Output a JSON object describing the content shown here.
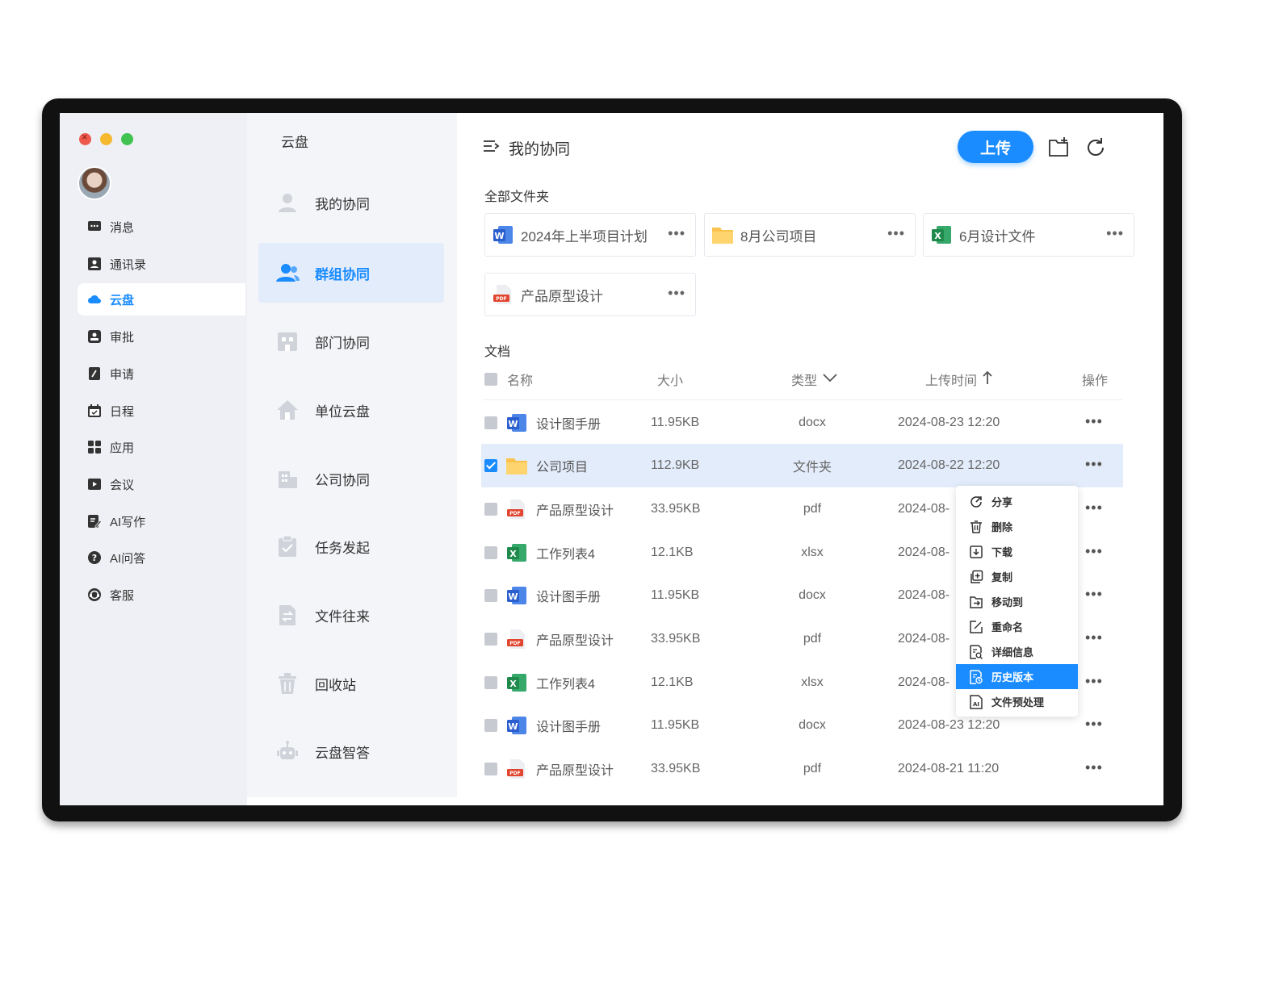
{
  "rail": {
    "items": [
      {
        "label": "消息",
        "icon": "message-icon"
      },
      {
        "label": "通讯录",
        "icon": "contacts-icon"
      },
      {
        "label": "云盘",
        "icon": "cloud-icon",
        "active": true
      },
      {
        "label": "审批",
        "icon": "approval-icon"
      },
      {
        "label": "申请",
        "icon": "apply-icon"
      },
      {
        "label": "日程",
        "icon": "calendar-icon"
      },
      {
        "label": "应用",
        "icon": "apps-icon"
      },
      {
        "label": "会议",
        "icon": "meeting-icon"
      },
      {
        "label": "AI写作",
        "icon": "ai-write-icon"
      },
      {
        "label": "AI问答",
        "icon": "ai-qa-icon"
      },
      {
        "label": "客服",
        "icon": "support-icon"
      }
    ]
  },
  "nav": {
    "title": "云盘",
    "items": [
      {
        "label": "我的协同",
        "icon": "person-icon"
      },
      {
        "label": "群组协同",
        "icon": "group-icon",
        "active": true
      },
      {
        "label": "部门协同",
        "icon": "department-icon"
      },
      {
        "label": "单位云盘",
        "icon": "home-icon"
      },
      {
        "label": "公司协同",
        "icon": "building-icon"
      },
      {
        "label": "任务发起",
        "icon": "task-icon"
      },
      {
        "label": "文件往来",
        "icon": "file-exchange-icon"
      },
      {
        "label": "回收站",
        "icon": "trash-icon"
      },
      {
        "label": "云盘智答",
        "icon": "robot-icon"
      }
    ]
  },
  "main": {
    "title": "我的协同",
    "upload_label": "上传",
    "folders_label": "全部文件夹",
    "folders": [
      {
        "name": "2024年上半项目计划",
        "type": "word"
      },
      {
        "name": "8月公司项目",
        "type": "folder"
      },
      {
        "name": "6月设计文件",
        "type": "excel"
      },
      {
        "name": "产品原型设计",
        "type": "pdf"
      }
    ],
    "docs_label": "文档",
    "columns": {
      "name": "名称",
      "size": "大小",
      "type": "类型",
      "time": "上传时间",
      "action": "操作"
    },
    "rows": [
      {
        "name": "设计图手册",
        "size": "11.95KB",
        "type": "docx",
        "time": "2024-08-23 12:20",
        "icon": "word",
        "checked": false
      },
      {
        "name": "公司项目",
        "size": "112.9KB",
        "type": "文件夹",
        "time": "2024-08-22 12:20",
        "icon": "folder",
        "checked": true
      },
      {
        "name": "产品原型设计",
        "size": "33.95KB",
        "type": "pdf",
        "time": "2024-08-",
        "icon": "pdf",
        "checked": false
      },
      {
        "name": "工作列表4",
        "size": "12.1KB",
        "type": "xlsx",
        "time": "2024-08-",
        "icon": "excel",
        "checked": false
      },
      {
        "name": "设计图手册",
        "size": "11.95KB",
        "type": "docx",
        "time": "2024-08-",
        "icon": "word",
        "checked": false
      },
      {
        "name": "产品原型设计",
        "size": "33.95KB",
        "type": "pdf",
        "time": "2024-08-",
        "icon": "pdf",
        "checked": false
      },
      {
        "name": "工作列表4",
        "size": "12.1KB",
        "type": "xlsx",
        "time": "2024-08-",
        "icon": "excel",
        "checked": false
      },
      {
        "name": "设计图手册",
        "size": "11.95KB",
        "type": "docx",
        "time": "2024-08-23 12:20",
        "icon": "word",
        "checked": false
      },
      {
        "name": "产品原型设计",
        "size": "33.95KB",
        "type": "pdf",
        "time": "2024-08-21 11:20",
        "icon": "pdf",
        "checked": false
      }
    ]
  },
  "menu": {
    "items": [
      {
        "label": "分享",
        "icon": "share-icon"
      },
      {
        "label": "删除",
        "icon": "delete-icon"
      },
      {
        "label": "下载",
        "icon": "download-icon"
      },
      {
        "label": "复制",
        "icon": "copy-icon"
      },
      {
        "label": "移动到",
        "icon": "move-icon"
      },
      {
        "label": "重命名",
        "icon": "rename-icon"
      },
      {
        "label": "详细信息",
        "icon": "details-icon"
      },
      {
        "label": "历史版本",
        "icon": "history-icon",
        "active": true
      },
      {
        "label": "文件预处理",
        "icon": "preprocess-icon"
      }
    ]
  },
  "colors": {
    "accent": "#1a8cff",
    "selected_row": "#e3ecfb",
    "word": "#2b5fce",
    "excel": "#1f8a4c",
    "pdf": "#e2452f",
    "folder": "#fbc34d"
  }
}
